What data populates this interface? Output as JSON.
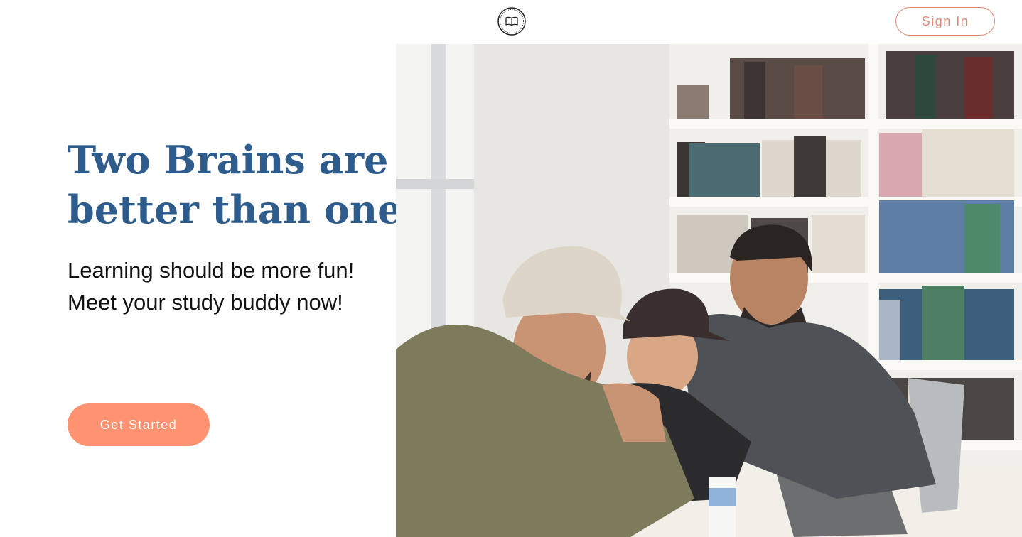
{
  "header": {
    "logo_icon": "open-book-icon",
    "signin_label": "Sign In"
  },
  "hero": {
    "headline_line1": "Two Brains are",
    "headline_line2": "better than one",
    "subtext_line1": "Learning should be more fun!",
    "subtext_line2": "Meet your study buddy now!",
    "cta_label": "Get Started",
    "image_subject": "three-students-laughing-at-laptop-in-library"
  },
  "colors": {
    "headline": "#2e5c8c",
    "accent": "#fe9271",
    "signin_border": "#e08a76",
    "text": "#111111"
  }
}
